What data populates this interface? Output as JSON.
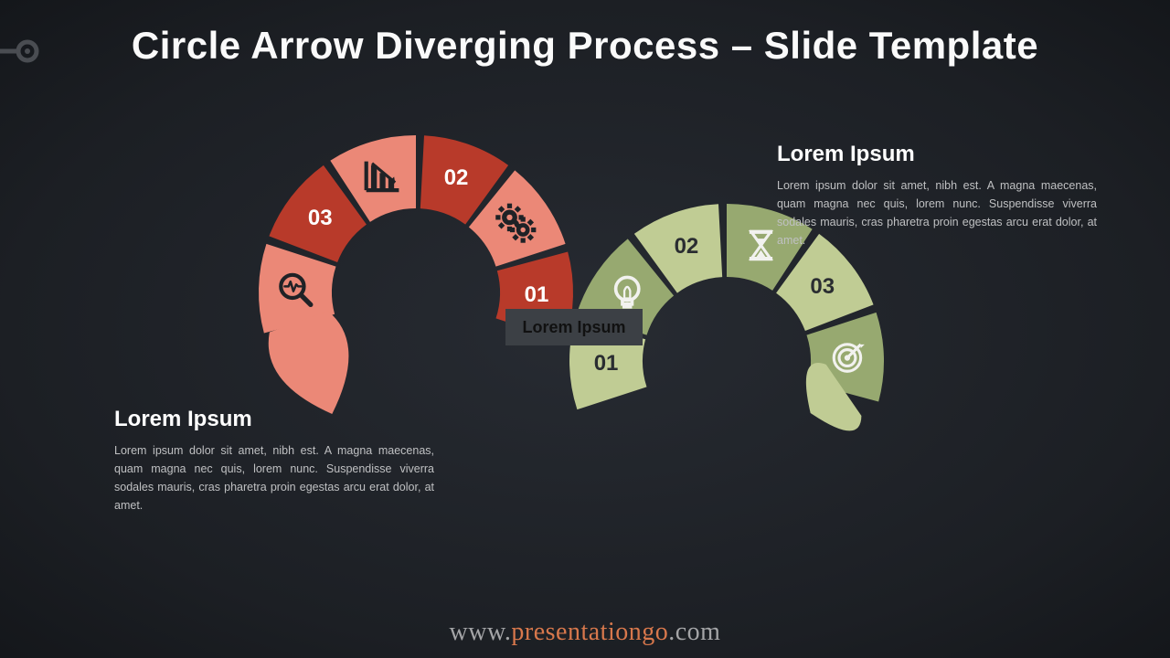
{
  "title": "Circle Arrow Diverging Process – Slide Template",
  "footer": {
    "pre": "www.",
    "mid": "presentationgo",
    "post": ".com"
  },
  "center_label": "Lorem Ipsum",
  "block_right": {
    "heading": "Lorem Ipsum",
    "body": "Lorem ipsum dolor sit amet, nibh est. A magna maecenas, quam magna nec quis, lorem nunc. Suspendisse viverra sodales mauris, cras pharetra proin egestas arcu erat dolor, at amet."
  },
  "block_left": {
    "heading": "Lorem Ipsum",
    "body": "Lorem ipsum dolor sit amet, nibh est. A magna maecenas, quam magna nec quis, lorem nunc. Suspendisse viverra sodales mauris, cras pharetra proin egestas arcu erat dolor, at amet."
  },
  "top_arc": {
    "segments": [
      {
        "label": "01",
        "color": "#b83a2a",
        "icon": ""
      },
      {
        "label": "",
        "color": "#eb8877",
        "icon": "gears"
      },
      {
        "label": "02",
        "color": "#b83a2a",
        "icon": ""
      },
      {
        "label": "",
        "color": "#eb8877",
        "icon": "chart"
      },
      {
        "label": "03",
        "color": "#b83a2a",
        "icon": ""
      },
      {
        "label": "",
        "color": "#eb8877",
        "icon": "search"
      }
    ],
    "arrow_color": "#eb8877"
  },
  "bottom_arc": {
    "segments": [
      {
        "label": "01",
        "color": "#c0cc94",
        "icon": ""
      },
      {
        "label": "",
        "color": "#97a970",
        "icon": "bulb"
      },
      {
        "label": "02",
        "color": "#c0cc94",
        "icon": ""
      },
      {
        "label": "",
        "color": "#97a970",
        "icon": "hourglass"
      },
      {
        "label": "03",
        "color": "#c0cc94",
        "icon": ""
      },
      {
        "label": "",
        "color": "#97a970",
        "icon": "target"
      }
    ],
    "arrow_color": "#c0cc94"
  },
  "icons": {
    "gears": "gears-icon",
    "chart": "bar-chart-down-icon",
    "search": "magnify-pulse-icon",
    "bulb": "lightbulb-icon",
    "hourglass": "hourglass-icon",
    "target": "target-icon"
  }
}
